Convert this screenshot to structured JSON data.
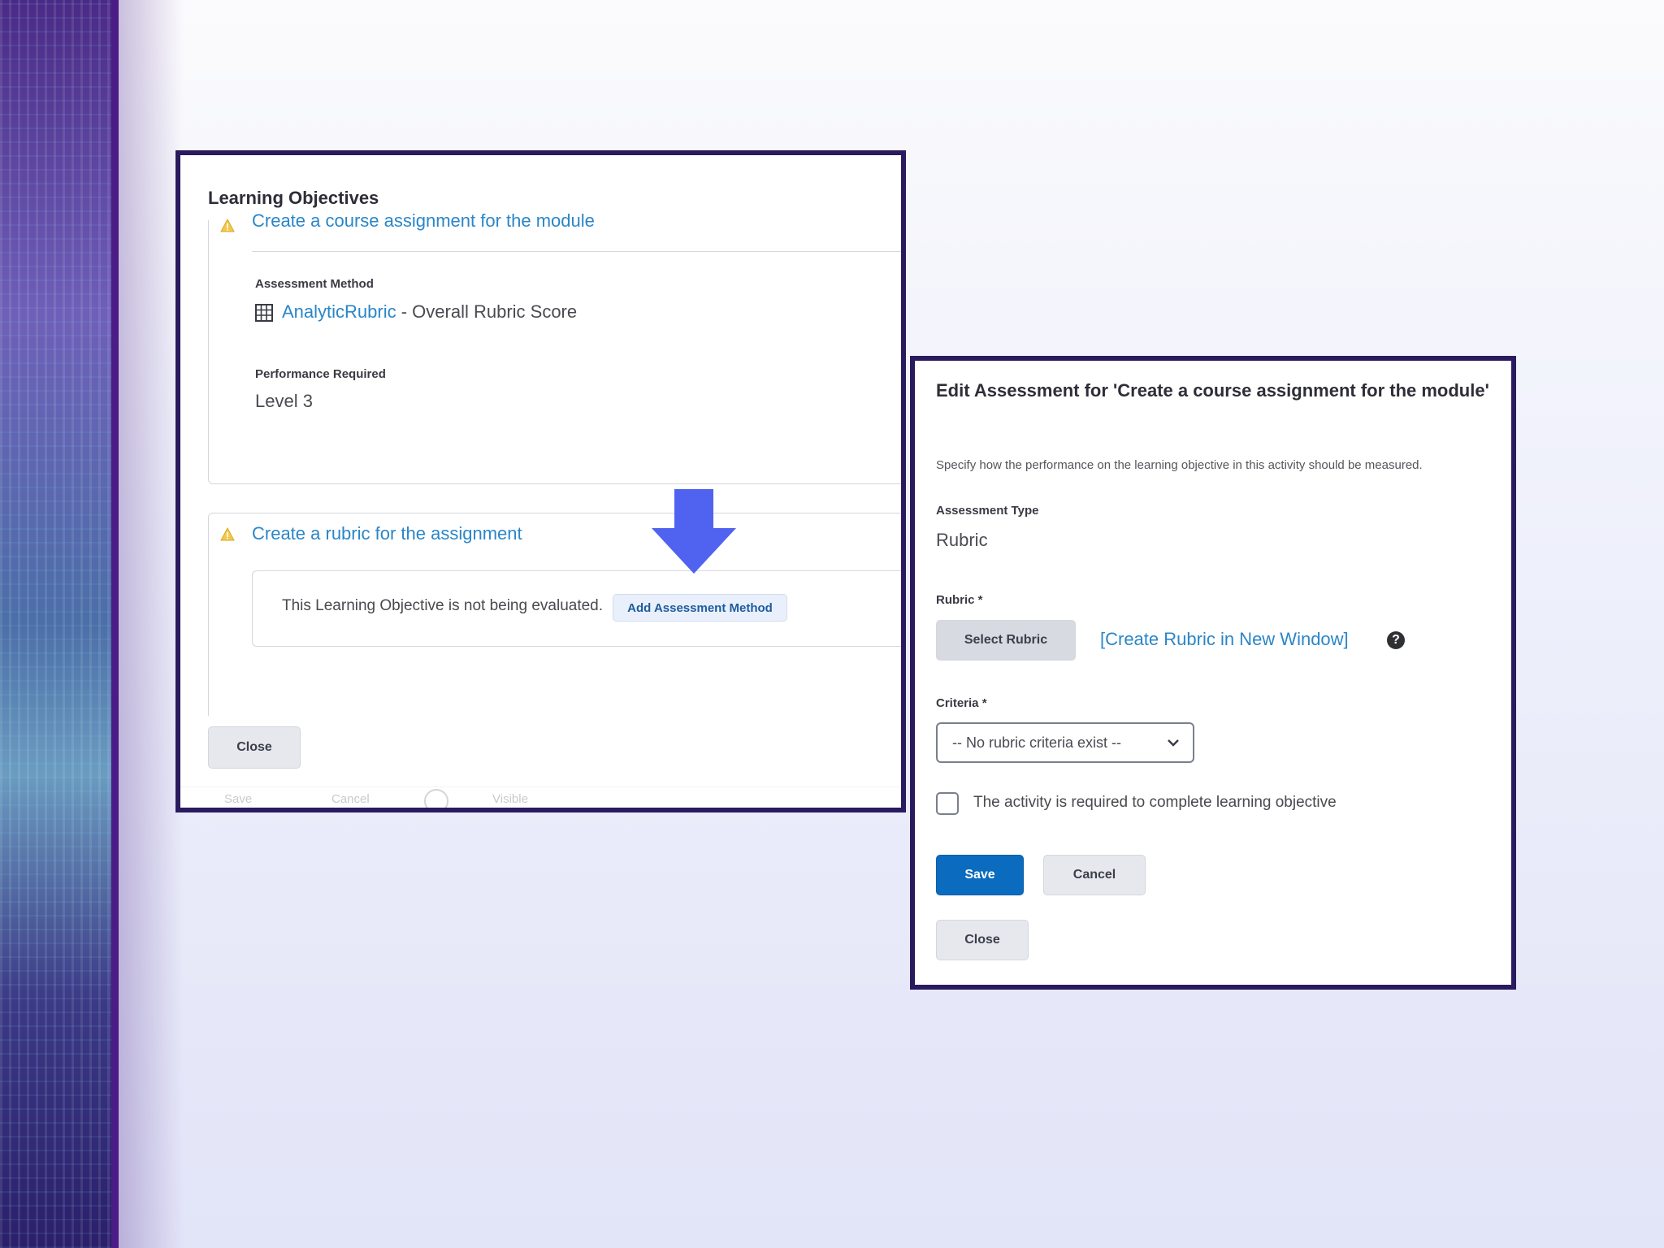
{
  "learning_objectives": {
    "title": "Learning Objectives",
    "objective1": {
      "title": "Create a course assignment for the module",
      "assessment_method_label": "Assessment Method",
      "assessment_method_link": "AnalyticRubric",
      "assessment_method_rest": " - Overall Rubric Score",
      "performance_label": "Performance Required",
      "performance_value": "Level 3"
    },
    "objective2": {
      "title": "Create a rubric for the assignment",
      "not_evaluated_text": "This Learning Objective is not being evaluated.",
      "add_method_button": "Add Assessment Method"
    },
    "close_button": "Close",
    "faded_footer": {
      "save": "Save",
      "cancel": "Cancel",
      "visible": "Visible"
    }
  },
  "edit_assessment": {
    "title": "Edit Assessment for 'Create a course assignment for the module'",
    "description": "Specify how the performance on the learning objective in this activity should be measured.",
    "assessment_type_label": "Assessment Type",
    "assessment_type_value": "Rubric",
    "rubric_label": "Rubric *",
    "select_rubric_button": "Select Rubric",
    "create_rubric_link": "[Create Rubric in New Window]",
    "criteria_label": "Criteria *",
    "criteria_select_value": "-- No rubric criteria exist --",
    "required_checkbox_label": "The activity is required to complete learning objective",
    "required_checked": false,
    "save_button": "Save",
    "cancel_button": "Cancel",
    "close_button": "Close"
  },
  "colors": {
    "panel_border": "#2a1a5e",
    "link": "#2a86c8",
    "primary_button": "#0b6bbf",
    "arrow": "#4f63f0",
    "warning": "#f2c94c"
  },
  "icons": {
    "warning": "warning-triangle-icon",
    "rubric": "grid-table-icon",
    "arrow": "arrow-down-icon",
    "help": "help-circle-icon",
    "chevron": "chevron-down-icon"
  }
}
